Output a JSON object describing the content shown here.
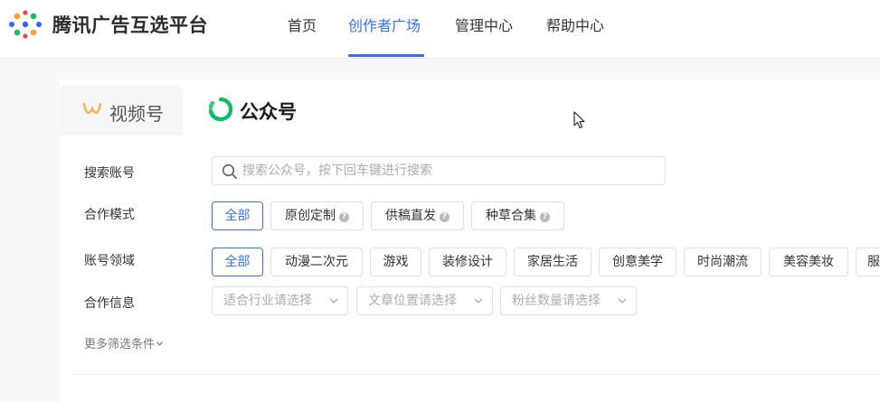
{
  "header": {
    "brand": "腾讯广告互选平台",
    "nav": [
      "首页",
      "创作者广场",
      "管理中心",
      "帮助中心"
    ],
    "active_nav": "创作者广场"
  },
  "platform_tabs": {
    "video": "视频号",
    "gzh": "公众号"
  },
  "filters": {
    "search_label": "搜索账号",
    "search_placeholder": "搜索公众号，按下回车键进行搜索",
    "mode_label": "合作模式",
    "modes": [
      "全部",
      "原创定制",
      "供稿直发",
      "种草合集"
    ],
    "domain_label": "账号领域",
    "domains": [
      "全部",
      "动漫二次元",
      "游戏",
      "装修设计",
      "家居生活",
      "创意美学",
      "时尚潮流",
      "美容美妆",
      "服"
    ],
    "info_label": "合作信息",
    "selects": [
      "适合行业请选择",
      "文章位置请选择",
      "粉丝数量请选择"
    ],
    "more": "更多筛选条件"
  },
  "colors": {
    "accent": "#3370ff",
    "wechat_green": "#07c160",
    "video_gold": "#f0b54a"
  }
}
